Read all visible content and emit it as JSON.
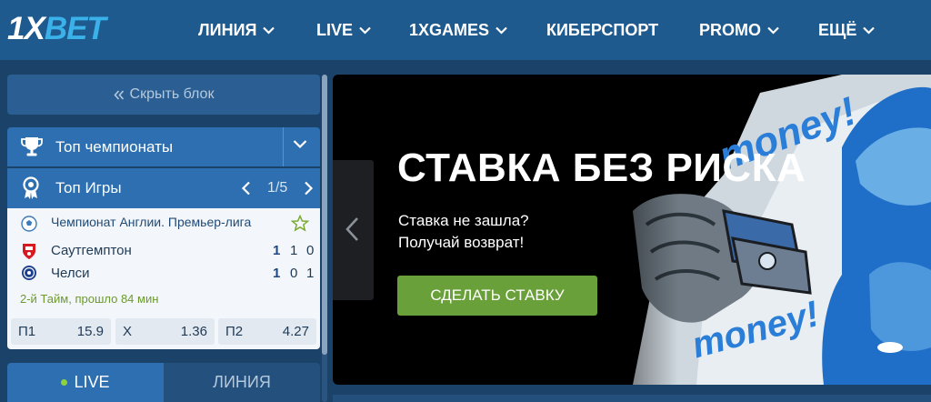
{
  "header": {
    "logo_main": "1X",
    "logo_accent": "BET",
    "nav": [
      {
        "label": "ЛИНИЯ",
        "dropdown": true
      },
      {
        "label": "LIVE",
        "dropdown": true
      },
      {
        "label": "1XGAMES",
        "dropdown": true
      },
      {
        "label": "КИБЕРСПОРТ",
        "dropdown": false
      },
      {
        "label": "PROMO",
        "dropdown": true
      },
      {
        "label": "ЕЩЁ",
        "dropdown": true
      }
    ]
  },
  "sidebar": {
    "hide_block_label": "Скрыть блок",
    "top_championships_label": "Топ чемпионаты",
    "top_games": {
      "label": "Топ Игры",
      "pager": "1/5"
    },
    "match": {
      "league": "Чемпионат Англии. Премьер-лига",
      "team1": "Саутгемптон",
      "team2": "Челси",
      "team1_scores": [
        "1",
        "1",
        "0"
      ],
      "team2_scores": [
        "1",
        "0",
        "1"
      ],
      "status": "2-й Тайм, прошло 84 мин",
      "odds": [
        {
          "label": "П1",
          "value": "15.9"
        },
        {
          "label": "X",
          "value": "1.36"
        },
        {
          "label": "П2",
          "value": "4.27"
        }
      ]
    },
    "tabs": {
      "live": "LIVE",
      "line": "ЛИНИЯ"
    }
  },
  "banner": {
    "title": "СТАВКА БЕЗ РИСКА",
    "subtitle_line1": "Ставка не зашла?",
    "subtitle_line2": "Получай возврат!",
    "cta": "СДЕЛАТЬ СТАВКУ",
    "art_text1": "money!",
    "art_text2": "money!"
  },
  "colors": {
    "header_bg": "#1e5a8e",
    "page_bg": "#1b4268",
    "accent_blue": "#3ab1e8",
    "cta_green": "#6aa03a",
    "live_dot": "#8ed23b"
  }
}
